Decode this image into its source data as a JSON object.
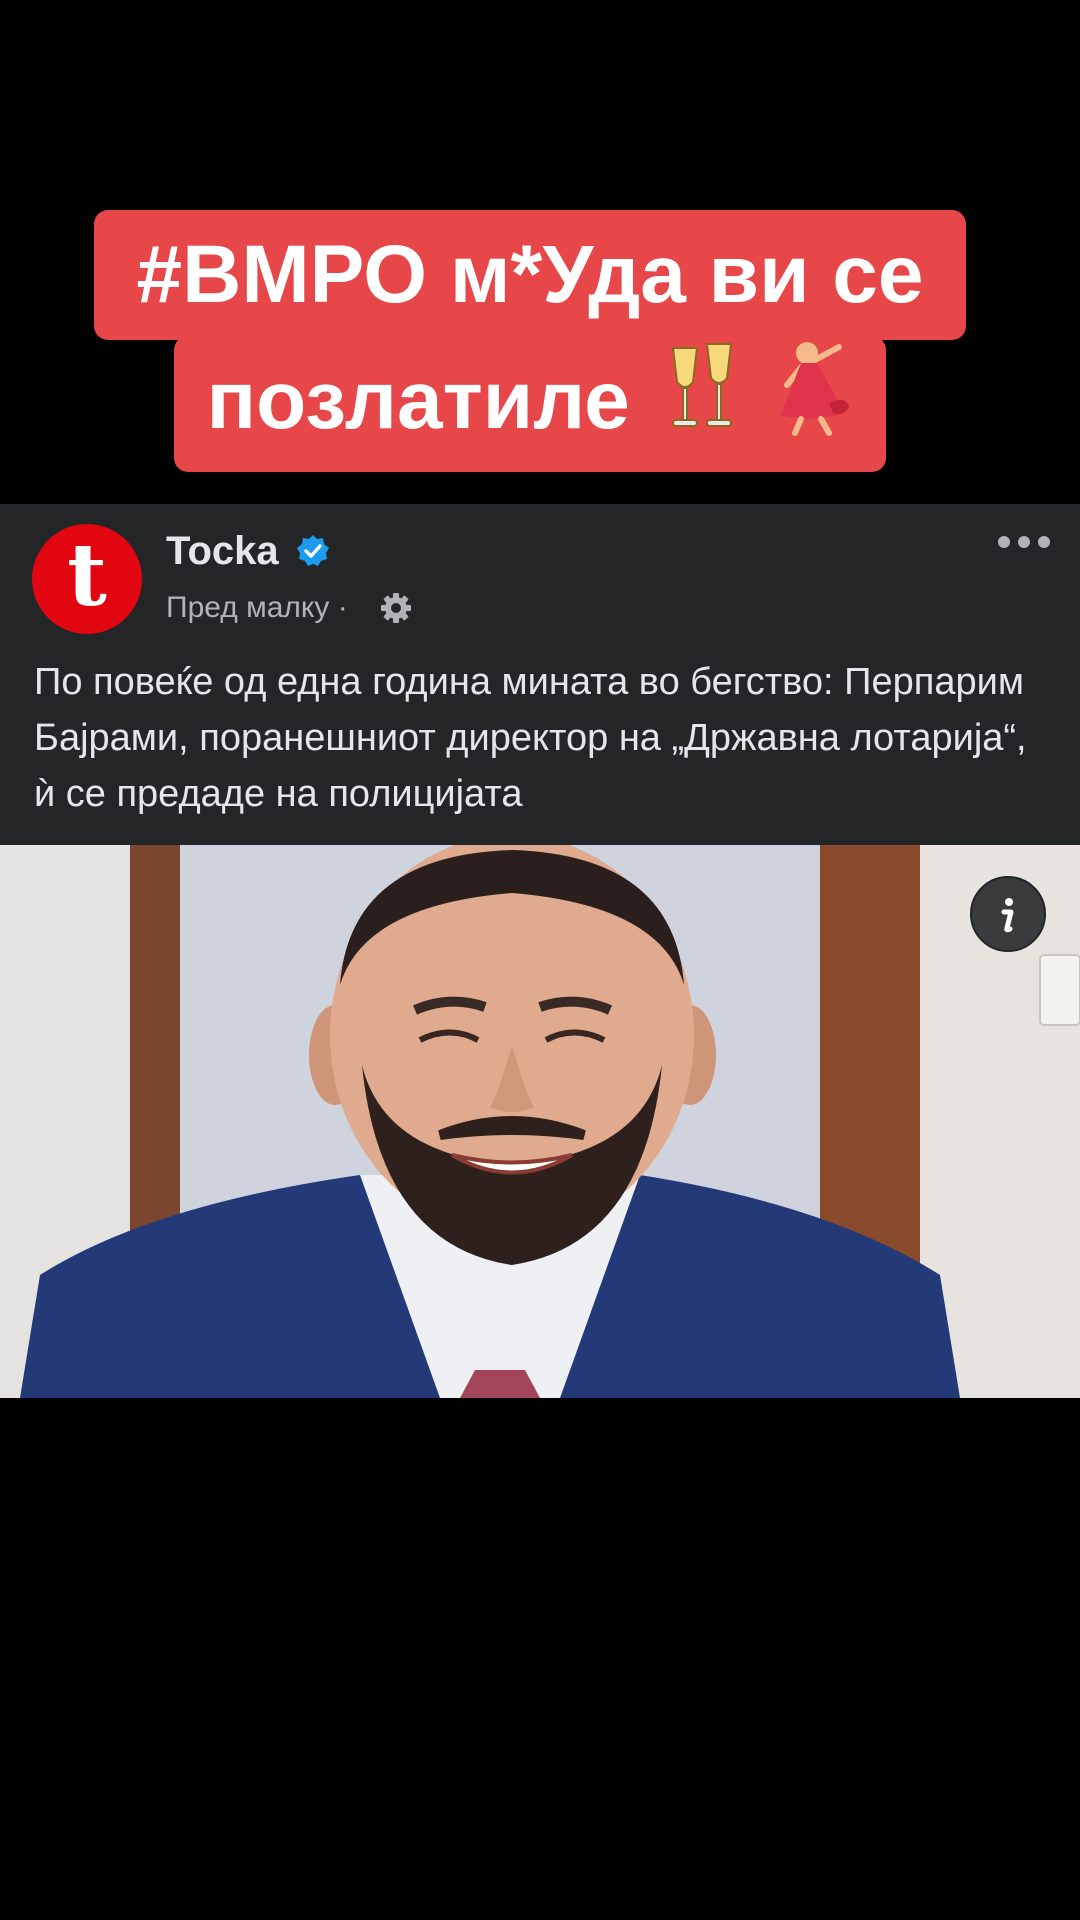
{
  "caption": {
    "line1": "#ВМРО м*Уда ви се",
    "line2": "позлатиле",
    "emojis": [
      "champagne-glasses",
      "dancing-woman"
    ]
  },
  "post": {
    "page_name": "Tocka",
    "avatar_letter": "t",
    "verified": true,
    "meta": "Пред малку ·",
    "audience_icon": "gear-icon",
    "more_icon": "more-options-icon",
    "text": "По повеќе од една година мината во бегство: Перпарим Бајрами, поранешниот директор на „Државна лотарија“, ѝ се предаде на полицијата",
    "photo_alt": "news-photo",
    "info_icon": "info-icon"
  },
  "colors": {
    "caption_bg": "#e8474a",
    "card_bg": "#242526",
    "brand_red": "#e1060f",
    "verified_blue": "#1d9bf0",
    "text_primary": "#e4e6eb",
    "text_secondary": "#b0b3b8"
  }
}
